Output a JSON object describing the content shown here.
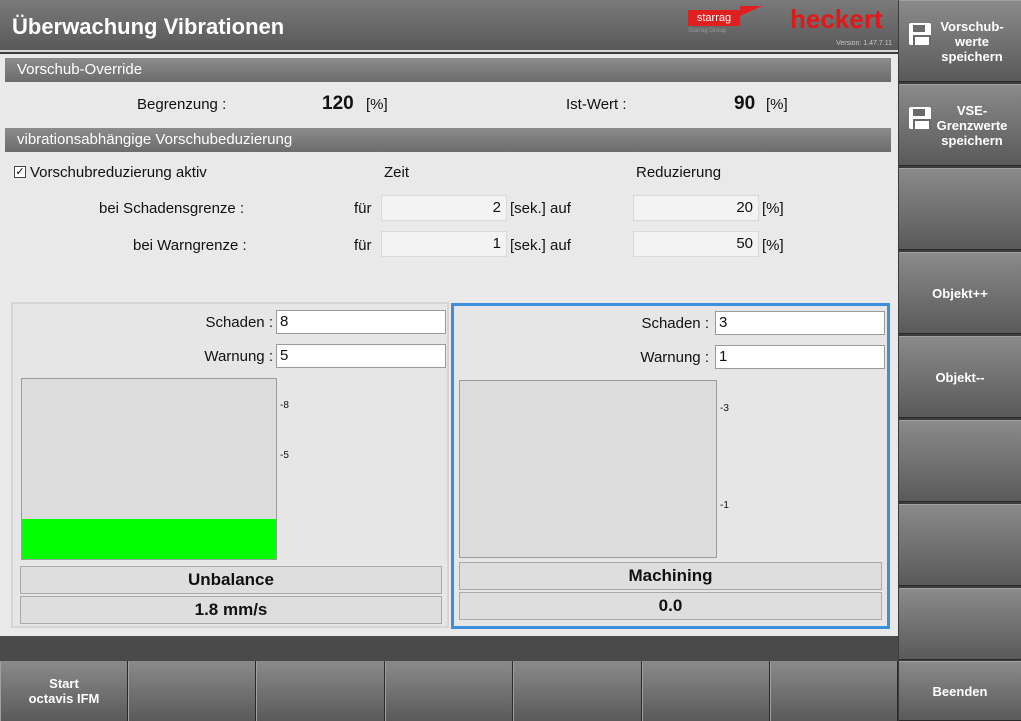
{
  "header": {
    "title": "Überwachung Vibrationen",
    "logo_starrag": "starrag",
    "logo_starrag_sub": "Starrag Group",
    "logo_heckert": "heckert",
    "version": "Version: 1.47.7.11"
  },
  "override": {
    "section_title": "Vorschub-Override",
    "limit_label": "Begrenzung :",
    "limit_value": "120",
    "limit_unit": "[%]",
    "actual_label": "Ist-Wert :",
    "actual_value": "90",
    "actual_unit": "[%]"
  },
  "reduction": {
    "section_title": "vibrationsabhängige Vorschubeduzierung",
    "checkbox_label": "Vorschubreduzierung aktiv",
    "checkbox_checked": true,
    "col_time": "Zeit",
    "col_reduction": "Reduzierung",
    "rows": [
      {
        "label": "bei Schadensgrenze :",
        "for": "für",
        "time": "2",
        "time_unit": "[sek.] auf",
        "reduction": "20",
        "reduction_unit": "[%]"
      },
      {
        "label": "bei Warngrenze :",
        "for": "für",
        "time": "1",
        "time_unit": "[sek.] auf",
        "reduction": "50",
        "reduction_unit": "[%]"
      }
    ]
  },
  "sensors": [
    {
      "damage_label": "Schaden :",
      "damage_value": "8",
      "warning_label": "Warnung :",
      "warning_value": "5",
      "tick_top": "-8",
      "tick_mid": "-5",
      "level_fraction": 0.22,
      "bar_color": "#00ff00",
      "name": "Unbalance",
      "value": "1.8 mm/s",
      "active": false
    },
    {
      "damage_label": "Schaden :",
      "damage_value": "3",
      "warning_label": "Warnung :",
      "warning_value": "1",
      "tick_top": "-3",
      "tick_mid": "-1",
      "level_fraction": 0,
      "bar_color": "#00ff00",
      "name": "Machining",
      "value": "0.0",
      "active": true
    }
  ],
  "right_buttons": [
    {
      "label": "Vorschub-\nwerte\nspeichern",
      "icon": "save-icon"
    },
    {
      "label": "VSE-\nGrenzwerte\nspeichern",
      "icon": "save-icon"
    },
    {
      "label": ""
    },
    {
      "label": "Objekt++"
    },
    {
      "label": "Objekt--"
    },
    {
      "label": ""
    },
    {
      "label": ""
    },
    {
      "label": ""
    },
    {
      "label": "Beenden"
    }
  ],
  "bottom_buttons": [
    {
      "label": "Start\noctavis IFM"
    },
    {
      "label": ""
    },
    {
      "label": ""
    },
    {
      "label": ""
    },
    {
      "label": ""
    },
    {
      "label": ""
    },
    {
      "label": ""
    }
  ],
  "colors": {
    "accent_active_border": "#3c8fdd",
    "brand_red": "#e01818"
  }
}
